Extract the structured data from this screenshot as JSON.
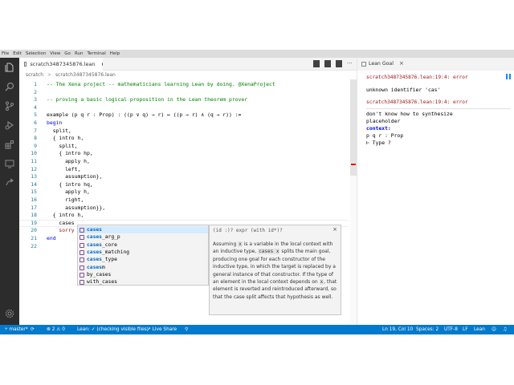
{
  "menu": [
    "File",
    "Edit",
    "Selection",
    "View",
    "Go",
    "Run",
    "Terminal",
    "Help"
  ],
  "tab": {
    "title": "scratch3487345876.lean"
  },
  "breadcrumb": {
    "folder": "scratch",
    "sep": ">",
    "file": "scratch3487345876.lean"
  },
  "editor": {
    "lines": [
      {
        "n": "1",
        "text": "-- The Xena project -- mathematicians learning Lean by doing. @XenaProject",
        "kind": "comment"
      },
      {
        "n": "2",
        "text": "",
        "kind": "code"
      },
      {
        "n": "3",
        "text": "-- proving a basic logical proposition in the Lean theorem prover",
        "kind": "comment"
      },
      {
        "n": "4",
        "text": "",
        "kind": "code"
      },
      {
        "n": "5",
        "text": "example (p q r : Prop) : ((p ∨ q) → r) ↔ ((p → r) ∧ (q → r)) :=",
        "kind": "example"
      },
      {
        "n": "6",
        "text": "begin",
        "kind": "keyword"
      },
      {
        "n": "7",
        "text": "  split,",
        "kind": "code"
      },
      {
        "n": "8",
        "text": "  { intro h,",
        "kind": "code"
      },
      {
        "n": "9",
        "text": "    split,",
        "kind": "code"
      },
      {
        "n": "10",
        "text": "    { intro hp,",
        "kind": "code"
      },
      {
        "n": "11",
        "text": "      apply h,",
        "kind": "code"
      },
      {
        "n": "12",
        "text": "      left,",
        "kind": "code"
      },
      {
        "n": "13",
        "text": "      assumption},",
        "kind": "code"
      },
      {
        "n": "14",
        "text": "    { intro hq,",
        "kind": "code"
      },
      {
        "n": "15",
        "text": "      apply h,",
        "kind": "code"
      },
      {
        "n": "16",
        "text": "      right,",
        "kind": "code"
      },
      {
        "n": "17",
        "text": "      assumption}},",
        "kind": "code"
      },
      {
        "n": "18",
        "text": "  { intro h,",
        "kind": "code"
      },
      {
        "n": "19",
        "text": "    cases",
        "kind": "code"
      },
      {
        "n": "20",
        "text": "    sorry",
        "kind": "sorry"
      },
      {
        "n": "21",
        "text": "end",
        "kind": "keyword"
      },
      {
        "n": "22",
        "text": "",
        "kind": "code"
      }
    ]
  },
  "suggest": {
    "items": [
      {
        "bold": "cases",
        "rest": ""
      },
      {
        "bold": "cases",
        "rest": "_arg_p"
      },
      {
        "bold": "cases",
        "rest": "_core"
      },
      {
        "bold": "cases",
        "rest": "_matching"
      },
      {
        "bold": "cases",
        "rest": "_type"
      },
      {
        "bold": "cases",
        "rest": "m"
      },
      {
        "bold": "",
        "rest": "by_cases"
      },
      {
        "bold": "",
        "rest": "with_cases"
      }
    ]
  },
  "detail": {
    "signature": "(id :)? expr (with id*)?",
    "close": "×",
    "doc": [
      {
        "t": "Assuming "
      },
      {
        "m": "x"
      },
      {
        "t": " is a variable in the local context with an inductive type, "
      },
      {
        "m": "cases x"
      },
      {
        "t": " splits the main goal, producing one goal for each constructor of the inductive type, in which the target is replaced by a general instance of that constructor. If the type of an element in the local context depends on "
      },
      {
        "m": "x"
      },
      {
        "t": ", that element is reverted and reintroduced afterward, so that the case split affects that hypothesis as well."
      }
    ]
  },
  "panel": {
    "tab_label": "Lean Goal",
    "close": "×",
    "err1_loc": "scratch3487345876.lean:19:4: error",
    "err1_msg": "unknown identifier 'cas'",
    "err2_loc": "scratch3487345876.lean:19:4: error",
    "err2_msg1": "don't know how to synthesize",
    "err2_msg2": "placeholder",
    "context_label": "context:",
    "hyp": "p q r : Prop",
    "goal": "⊢ Type ?"
  },
  "status": {
    "branch": "master*",
    "errors": "2",
    "warnings": "0",
    "lean": "Lean: ✓ (checking visible files)",
    "liveshare": "Live Share",
    "position": "Ln 19, Col 10",
    "spaces": "Spaces: 2",
    "encoding": "UTF-8",
    "eol": "LF",
    "language": "Lean"
  },
  "colors": {
    "accent": "#007acc",
    "activity": "#2c2c2c",
    "error": "#a31515"
  }
}
